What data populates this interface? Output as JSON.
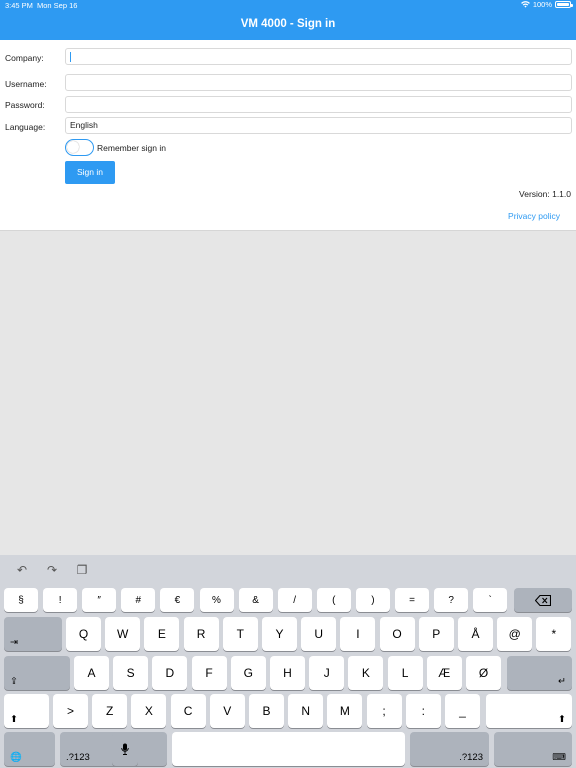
{
  "status_bar": {
    "time": "3:45 PM",
    "date": "Mon Sep 16",
    "battery": "100%"
  },
  "header": {
    "title": "VM 4000 - Sign in"
  },
  "form": {
    "company_label": "Company:",
    "company_value": "",
    "username_label": "Username:",
    "username_value": "",
    "password_label": "Password:",
    "password_value": "",
    "language_label": "Language:",
    "language_value": "English",
    "remember_label": "Remember sign in",
    "remember_on": false,
    "sign_in_label": "Sign in",
    "version": "Version: 1.1.0",
    "privacy_label": "Privacy policy"
  },
  "keyboard": {
    "toolbar": [
      "undo-icon",
      "redo-icon",
      "paste-icon"
    ],
    "row1": [
      "§",
      "!",
      "″",
      "#",
      "€",
      "%",
      "&",
      "/",
      "(",
      ")",
      "=",
      "?",
      "`"
    ],
    "row2": [
      "Q",
      "W",
      "E",
      "R",
      "T",
      "Y",
      "U",
      "I",
      "O",
      "P",
      "Å",
      "@",
      "*"
    ],
    "row3": [
      "A",
      "S",
      "D",
      "F",
      "G",
      "H",
      "J",
      "K",
      "L",
      "Æ",
      "Ø"
    ],
    "row4": [
      ">",
      "Z",
      "X",
      "C",
      "V",
      "B",
      "N",
      "M",
      ";",
      ":",
      "_"
    ],
    "numbers_label": ".?123"
  }
}
